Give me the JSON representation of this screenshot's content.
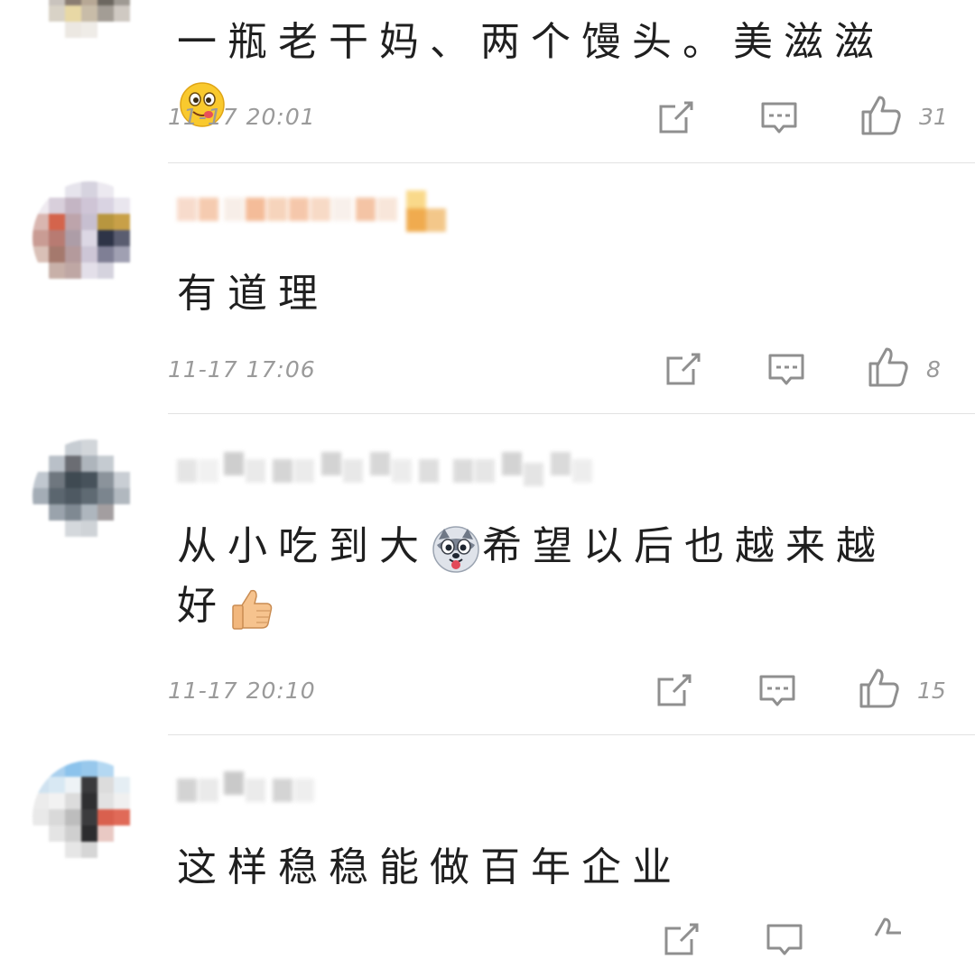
{
  "comments": [
    {
      "text_parts": [
        "一瓶老干妈、两个馒头。美滋滋"
      ],
      "emoji": "yum-face-emoji",
      "time": "11-17 20:01",
      "likes": "31"
    },
    {
      "text_parts": [
        "有道理"
      ],
      "time": "11-17 17:06",
      "likes": "8"
    },
    {
      "text_parts": [
        "从小吃到大",
        "希望以后也越来越",
        "好"
      ],
      "emoji": "husky-emoji",
      "emoji2": "thumbs-up-emoji",
      "time": "11-17 20:10",
      "likes": "15"
    },
    {
      "text_parts": [
        "这样稳稳能做百年企业"
      ]
    }
  ],
  "colors": {
    "meta_gray": "#9a9a9a",
    "divider": "#e2e2e2",
    "text": "#1f1f1f"
  }
}
